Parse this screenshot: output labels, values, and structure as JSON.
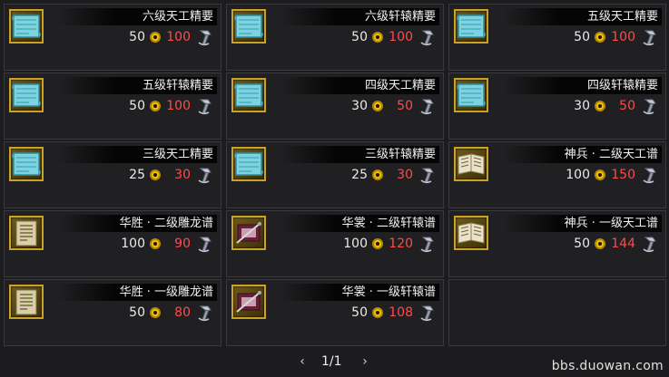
{
  "items": [
    {
      "name": "六级天工精要",
      "qty": "50",
      "price": "100",
      "icon": "blueprint-scroll-icon"
    },
    {
      "name": "六级轩辕精要",
      "qty": "50",
      "price": "100",
      "icon": "blueprint-scroll-icon"
    },
    {
      "name": "五级天工精要",
      "qty": "50",
      "price": "100",
      "icon": "blueprint-scroll-icon"
    },
    {
      "name": "五级轩辕精要",
      "qty": "50",
      "price": "100",
      "icon": "blueprint-scroll-icon"
    },
    {
      "name": "四级天工精要",
      "qty": "30",
      "price": "50",
      "icon": "blueprint-scroll-icon"
    },
    {
      "name": "四级轩辕精要",
      "qty": "30",
      "price": "50",
      "icon": "blueprint-scroll-icon"
    },
    {
      "name": "三级天工精要",
      "qty": "25",
      "price": "30",
      "icon": "blueprint-scroll-icon"
    },
    {
      "name": "三级轩辕精要",
      "qty": "25",
      "price": "30",
      "icon": "blueprint-scroll-icon"
    },
    {
      "name": "神兵 · 二级天工谱",
      "qty": "100",
      "price": "150",
      "icon": "open-book-icon"
    },
    {
      "name": "华胜 · 二级雕龙谱",
      "qty": "100",
      "price": "90",
      "icon": "paper-manual-icon"
    },
    {
      "name": "华裳 · 二级轩辕谱",
      "qty": "100",
      "price": "120",
      "icon": "sewing-manual-icon"
    },
    {
      "name": "神兵 · 一级天工谱",
      "qty": "50",
      "price": "144",
      "icon": "open-book-icon"
    },
    {
      "name": "华胜 · 一级雕龙谱",
      "qty": "50",
      "price": "80",
      "icon": "paper-manual-icon"
    },
    {
      "name": "华裳 · 一级轩辕谱",
      "qty": "50",
      "price": "108",
      "icon": "sewing-manual-icon"
    }
  ],
  "pager": {
    "label": "1/1"
  },
  "site": "bbs.duowan.com",
  "colors": {
    "price": "#ff4a4a",
    "coin": "#f2c200",
    "icon_border": "#c9a227"
  }
}
